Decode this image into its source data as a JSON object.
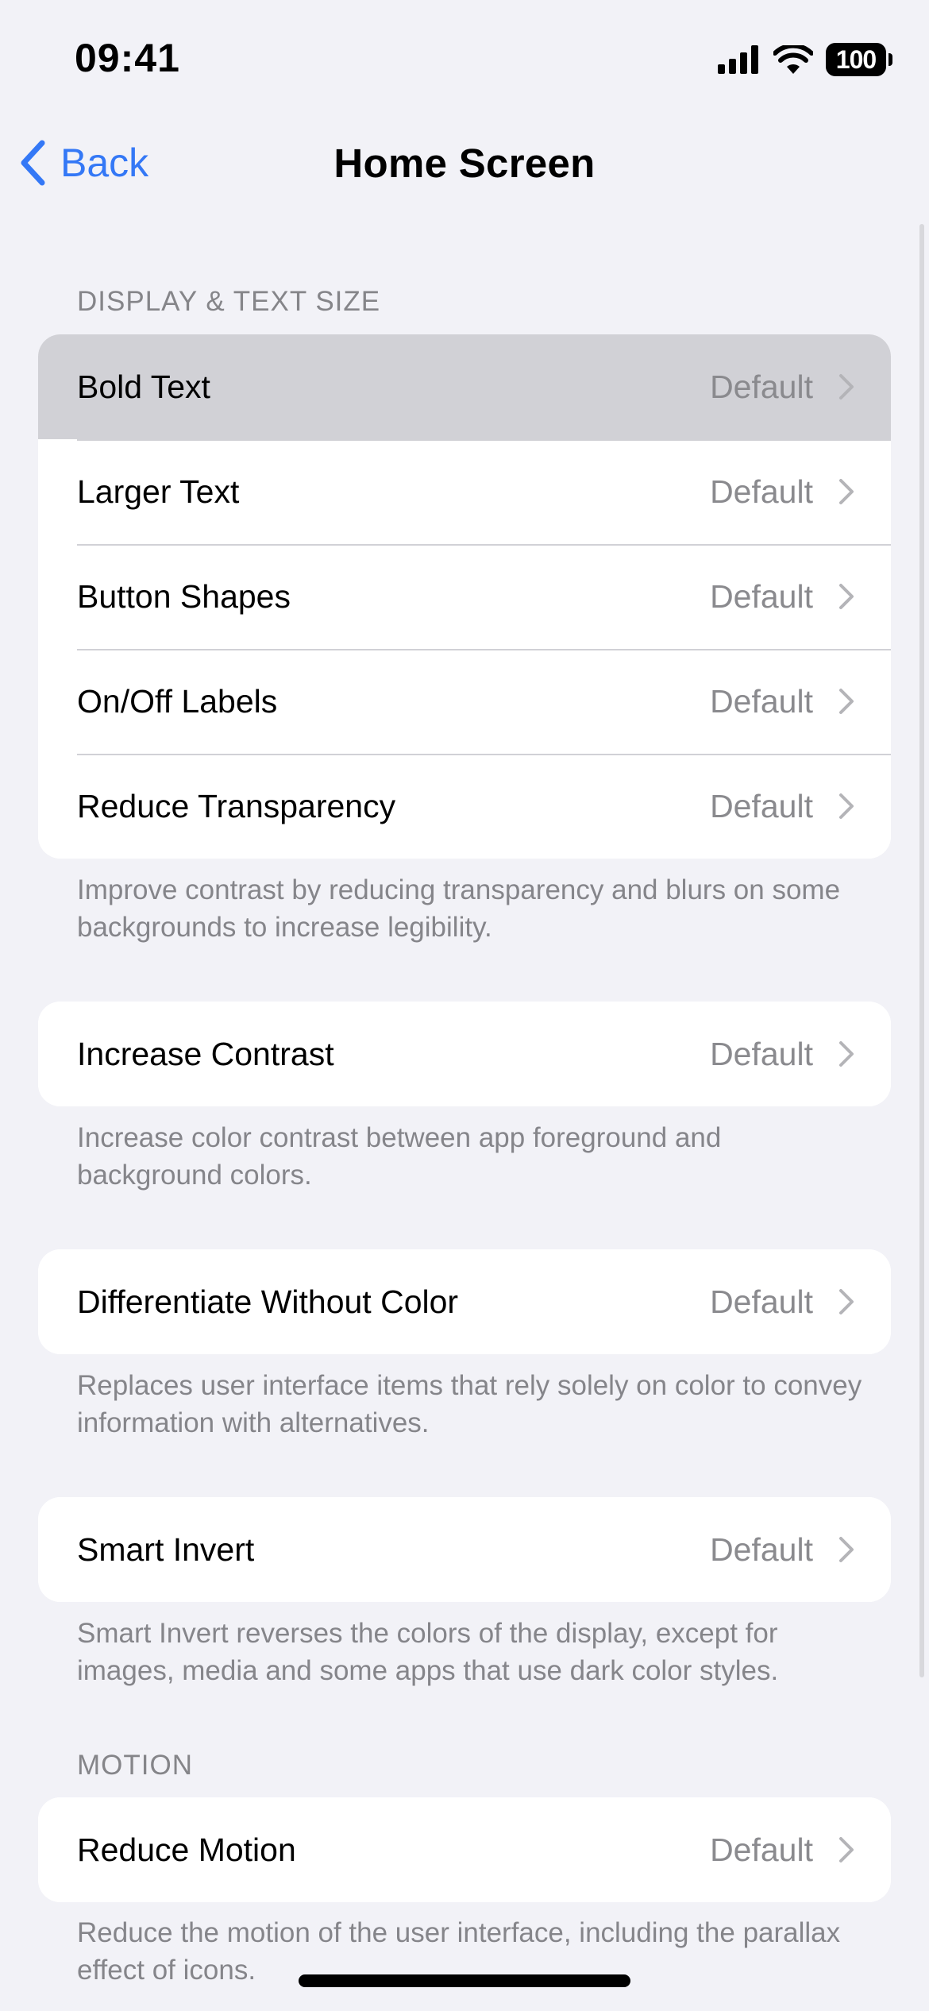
{
  "status_bar": {
    "time": "09:41",
    "battery": "100"
  },
  "nav": {
    "back_label": "Back",
    "title": "Home Screen"
  },
  "sections": {
    "display": {
      "header": "DISPLAY & TEXT SIZE",
      "rows": [
        {
          "label": "Bold Text",
          "value": "Default"
        },
        {
          "label": "Larger Text",
          "value": "Default"
        },
        {
          "label": "Button Shapes",
          "value": "Default"
        },
        {
          "label": "On/Off Labels",
          "value": "Default"
        },
        {
          "label": "Reduce Transparency",
          "value": "Default"
        }
      ],
      "footer": "Improve contrast by reducing transparency and blurs on some backgrounds to increase legibility."
    },
    "contrast": {
      "label": "Increase Contrast",
      "value": "Default",
      "footer": "Increase color contrast between app foreground and background colors."
    },
    "differentiate": {
      "label": "Differentiate Without Color",
      "value": "Default",
      "footer": "Replaces user interface items that rely solely on color to convey information with alternatives."
    },
    "invert": {
      "label": "Smart Invert",
      "value": "Default",
      "footer": "Smart Invert reverses the colors of the display, except for images, media and some apps that use dark color styles."
    },
    "motion": {
      "header": "MOTION",
      "label": "Reduce Motion",
      "value": "Default",
      "footer": "Reduce the motion of the user interface, including the parallax effect of icons."
    }
  },
  "colors": {
    "accent": "#3478f6",
    "background": "#f2f2f7",
    "secondary_text": "#8a8a8e",
    "highlight_row": "#d1d1d6"
  },
  "icons": {
    "back": "chevron-left-icon",
    "row_disclosure": "chevron-right-icon",
    "signal": "cellular-signal-icon",
    "wifi": "wifi-icon",
    "battery": "battery-icon"
  }
}
